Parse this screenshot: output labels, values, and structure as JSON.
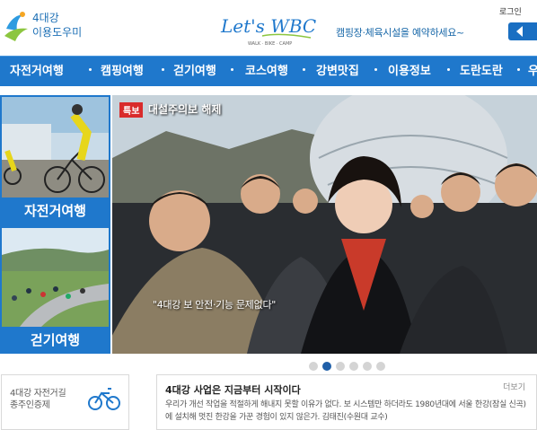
{
  "header": {
    "logo_text_line1": "4대강",
    "logo_text_line2": "이용도우미",
    "brand_name": "Let's WBC",
    "brand_sub": "WALK · BIKE · CAMP",
    "slogan": "캠핑장·체육시설을 예약하세요~",
    "login_label": "로그인"
  },
  "nav": {
    "items": [
      "자전거여행",
      "캠핑여행",
      "걷기여행",
      "코스여행",
      "강변맛집",
      "이용정보",
      "도란도란",
      "우"
    ]
  },
  "side": {
    "label1": "자전거여행",
    "label2": "걷기여행"
  },
  "hero": {
    "badge": "특보",
    "title": "대설주의보 해제",
    "caption": "\"4대강 보 안전·기능 문제없다\""
  },
  "slider": {
    "total": 6,
    "active": 1
  },
  "box_left": {
    "line1": "4대강 자전거길",
    "line2": "종주인증제"
  },
  "box_main": {
    "title": "4대강 사업은 지금부터 시작이다",
    "more": "더보기",
    "text": "우리가 개선 작업을 적절하게 해내지 못할 이유가 없다. 보 시스템만 하더라도 1980년대에 서울 한강(잠실 신곡)에 설치해 멋진 한강을 가꾼 경험이 있지 않은가. 김태진(수원대 교수)"
  },
  "colors": {
    "nav_blue": "#1f78cc",
    "badge_red": "#d92b2b",
    "dot_active": "#1f5fa8"
  }
}
